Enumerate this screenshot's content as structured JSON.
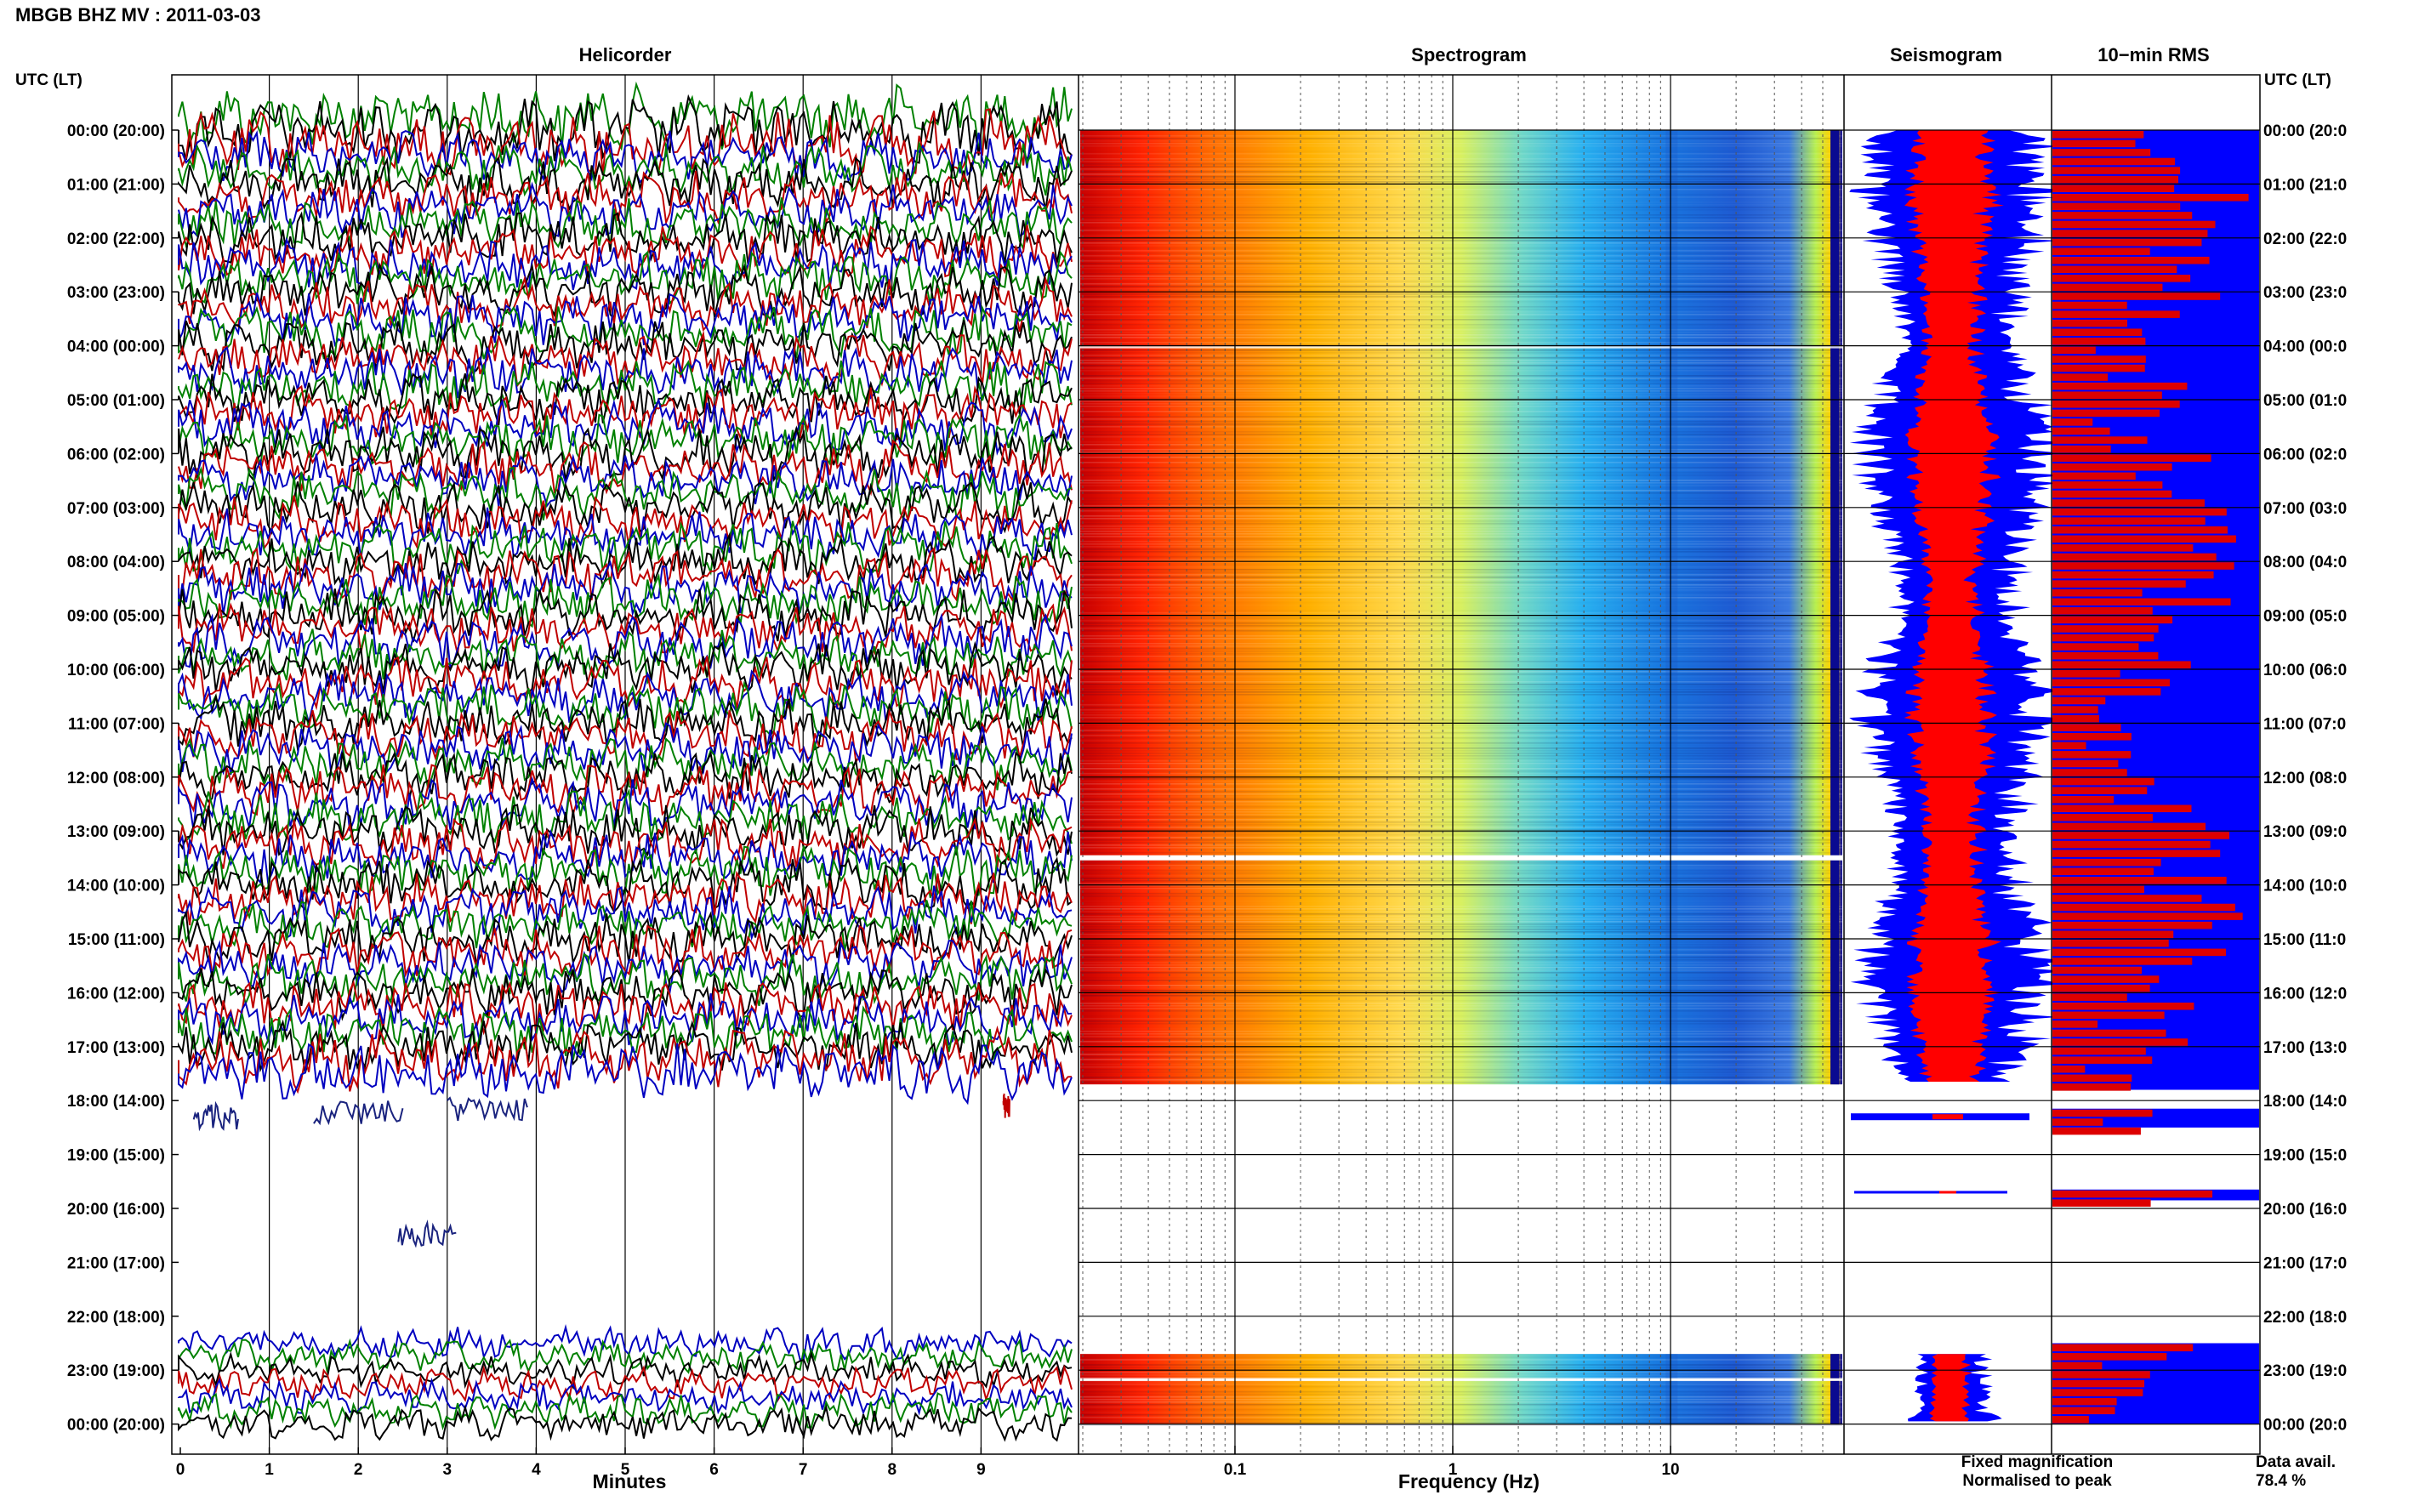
{
  "header": {
    "title": "MBGB BHZ MV : 2011-03-03"
  },
  "chart_data": {
    "type": "helicorder",
    "station_title": "MBGB BHZ MV : 2011-03-03",
    "panels": {
      "helicorder": "Helicorder",
      "spectrogram": "Spectrogram",
      "seismogram": "Seismogram",
      "rms": "10−min RMS"
    },
    "left_axis_label": "UTC (LT)",
    "right_axis_label": "UTC (LT)",
    "hour_labels": [
      "00:00 (20:00)",
      "01:00 (21:00)",
      "02:00 (22:00)",
      "03:00 (23:00)",
      "04:00 (00:00)",
      "05:00 (01:00)",
      "06:00 (02:00)",
      "07:00 (03:00)",
      "08:00 (04:00)",
      "09:00 (05:00)",
      "10:00 (06:00)",
      "11:00 (07:00)",
      "12:00 (08:00)",
      "13:00 (09:00)",
      "14:00 (10:00)",
      "15:00 (11:00)",
      "16:00 (12:00)",
      "17:00 (13:00)",
      "18:00 (14:00)",
      "19:00 (15:00)",
      "20:00 (16:00)",
      "21:00 (17:00)",
      "22:00 (18:00)",
      "23:00 (19:00)",
      "00:00 (20:00)"
    ],
    "right_hour_labels": [
      "00:00 (20:0",
      "01:00 (21:0",
      "02:00 (22:0",
      "03:00 (23:0",
      "04:00 (00:0",
      "05:00 (01:0",
      "06:00 (02:0",
      "07:00 (03:0",
      "08:00 (04:0",
      "09:00 (05:0",
      "10:00 (06:0",
      "11:00 (07:0",
      "12:00 (08:0",
      "13:00 (09:0",
      "14:00 (10:0",
      "15:00 (11:0",
      "16:00 (12:0",
      "17:00 (13:0",
      "18:00 (14:0",
      "19:00 (15:0",
      "20:00 (16:0",
      "21:00 (17:0",
      "22:00 (18:0",
      "23:00 (19:0",
      "00:00 (20:0"
    ],
    "x_minutes": {
      "label": "Minutes",
      "min": 0,
      "max": 10,
      "ticks": [
        "0",
        "1",
        "2",
        "3",
        "4",
        "5",
        "6",
        "7",
        "8",
        "9"
      ]
    },
    "x_frequency": {
      "label": "Frequency (Hz)",
      "scale": "log",
      "min": 0.02,
      "max": 50,
      "ticks": [
        "0.1",
        "1",
        "10"
      ]
    },
    "trace_colors": [
      "#000000",
      "#c00000",
      "#0000c0",
      "#008000"
    ],
    "data_gap_hours": [
      17.8,
      22.5
    ],
    "legend": {
      "fixed": "Fixed magnification",
      "normalised": "Normalised to peak",
      "fixed_color": "#0000ff",
      "normalised_color": "#ff0000"
    },
    "data_availability_label": "Data avail.",
    "data_availability": "78.4 %",
    "rms_blue_color": "#0000ff",
    "rms_red_color": "#dd0000"
  }
}
